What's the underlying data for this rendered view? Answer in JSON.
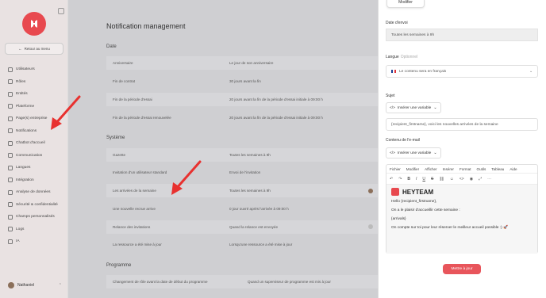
{
  "sidebar": {
    "back_label": "Retour au menu",
    "items": [
      {
        "label": "Utilisateurs",
        "icon": "users-icon"
      },
      {
        "label": "Rôles",
        "icon": "roles-icon"
      },
      {
        "label": "Entités",
        "icon": "entities-icon"
      },
      {
        "label": "Plateforme",
        "icon": "platform-icon"
      },
      {
        "label": "Page(s) entreprise",
        "icon": "page-icon"
      },
      {
        "label": "Notifications",
        "icon": "bell-icon"
      },
      {
        "label": "Chatbot d'accueil",
        "icon": "chatbot-icon"
      },
      {
        "label": "Communication",
        "icon": "chat-icon"
      },
      {
        "label": "Langues",
        "icon": "language-icon"
      },
      {
        "label": "Intégration",
        "icon": "integration-icon"
      },
      {
        "label": "Analyse de données",
        "icon": "analytics-icon"
      },
      {
        "label": "Sécurité & confidentialité",
        "icon": "security-icon"
      },
      {
        "label": "Champs personnalisés",
        "icon": "fields-icon"
      },
      {
        "label": "Logs",
        "icon": "logs-icon"
      },
      {
        "label": "IA",
        "icon": "ai-icon"
      }
    ],
    "user_name": "Nathaniel"
  },
  "main": {
    "title": "Notification management",
    "sections": [
      {
        "title": "Date",
        "rows": [
          {
            "name": "Anniversaire",
            "value": "Le jour de son anniversaire"
          },
          {
            "name": "Fin de contrat",
            "value": "30 jours avant la fin"
          },
          {
            "name": "Fin de la période d'essai",
            "value": "20 jours avant la fin de la période d'essai initiale à 09:00 h"
          },
          {
            "name": "Fin de la période d'essai renouvelée",
            "value": "20 jours avant la fin de la période d'essai initiale à 09:00 h"
          }
        ]
      },
      {
        "title": "Système",
        "rows": [
          {
            "name": "Gazette",
            "value": "Toutes les semaines à 9h"
          },
          {
            "name": "Invitation d'un utilisateur standard",
            "value": "Envoi de l'invitation"
          },
          {
            "name": "Les arrivées de la semaine",
            "value": "Toutes les semaines à 9h"
          },
          {
            "name": "Une nouvelle recrue arrive",
            "value": "0 jour ouvré après l'arrivée à 09:00 h"
          },
          {
            "name": "Relance des invitations",
            "value": "Quand la relance est envoyée"
          },
          {
            "name": "La ressource a été mise à jour",
            "value": "Lorsqu'une ressource a été mise à jour"
          }
        ]
      },
      {
        "title": "Programme",
        "rows": [
          {
            "name": "Changement de rôle avant la date de début du programme",
            "value": "Quand un superviseur de programme est mis à jour"
          }
        ]
      }
    ]
  },
  "panel": {
    "modify_label": "Modifier",
    "date_label": "Date d'envoi",
    "date_value": "Toutes les semaines à 9h",
    "lang_label": "Langue",
    "lang_optional": "Optionnel",
    "lang_value": "Le contenu sera en français",
    "subject_label": "Sujet",
    "insert_var_label": "Insérer une variable",
    "subject_value": "{recipient_firstname}, voici les nouvelles arrivées de la semaine",
    "content_label": "Contenu de l'e-mail",
    "menubar": [
      "Fichier",
      "Modifier",
      "Afficher",
      "Insérer",
      "Format",
      "Outils",
      "Tableau",
      "Aide"
    ],
    "brand": "HEYTEAM",
    "email_lines": [
      "Hello {recipient_firstname},",
      "On a le plaisir d'accueillir cette semaine :",
      "{arrivals}",
      "On compte sur toi pour leur réserver le meilleur accueil possible :) 🚀"
    ],
    "save_label": "Mettre à jour"
  },
  "colors": {
    "accent": "#e8494f",
    "save_button": "#e8555b",
    "overlay": "#cfcfd2"
  }
}
